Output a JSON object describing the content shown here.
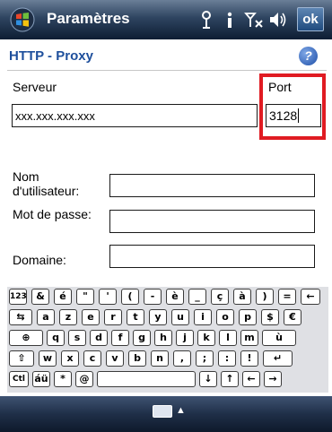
{
  "titlebar": {
    "title": "Paramètres",
    "ok_label": "ok",
    "icons": [
      "windows-start-icon",
      "connectivity-icon",
      "notification-icon",
      "signal-off-icon",
      "volume-icon"
    ]
  },
  "header": {
    "title": "HTTP - Proxy",
    "help_label": "?"
  },
  "form": {
    "server_label": "Serveur",
    "server_value": "xxx.xxx.xxx.xxx",
    "port_label": "Port",
    "port_value": "3128",
    "username_label": "Nom d'utilisateur:",
    "username_value": "",
    "password_label": "Mot de passe:",
    "password_value": "",
    "domain_label": "Domaine:",
    "domain_value": ""
  },
  "keyboard": {
    "rows": [
      [
        "123",
        "&",
        "é",
        "\"",
        "'",
        "(",
        "-",
        "è",
        "_",
        "ç",
        "à",
        ")",
        "=",
        "←"
      ],
      [
        "⇆",
        "a",
        "z",
        "e",
        "r",
        "t",
        "y",
        "u",
        "i",
        "o",
        "p",
        "$",
        "€"
      ],
      [
        "⊕",
        "q",
        "s",
        "d",
        "f",
        "g",
        "h",
        "j",
        "k",
        "l",
        "m",
        "ù"
      ],
      [
        "⇧",
        "w",
        "x",
        "c",
        "v",
        "b",
        "n",
        ",",
        ";",
        ":",
        "!",
        "↵"
      ],
      [
        "Ctl",
        "áü",
        "*",
        "@",
        "",
        "↓",
        "↑",
        "←",
        "→"
      ]
    ]
  },
  "colors": {
    "accent": "#1e4f9c",
    "highlight": "#e01b22",
    "titlebar": "#1f3452"
  }
}
